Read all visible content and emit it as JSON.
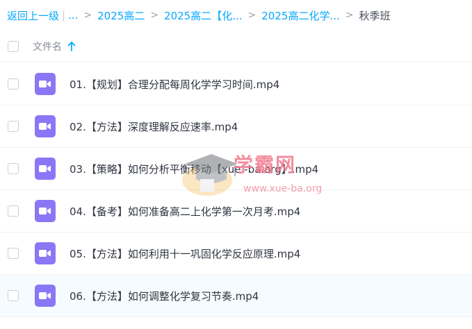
{
  "breadcrumb": {
    "back": "返回上一级",
    "ellipsis": "...",
    "items": [
      "2025高二",
      "2025高二【化...",
      "2025高二化学...",
      "秋季班"
    ]
  },
  "header": {
    "column_name": "文件名"
  },
  "files": [
    {
      "name": "01.【规划】合理分配每周化学学习时间.mp4"
    },
    {
      "name": "02.【方法】深度理解反应速率.mp4"
    },
    {
      "name": "03.【策略】如何分析平衡移动【xue -ba.org】.mp4"
    },
    {
      "name": "04.【备考】如何准备高二上化学第一次月考.mp4"
    },
    {
      "name": "05.【方法】如何利用十一巩固化学反应原理.mp4"
    },
    {
      "name": "06.【方法】如何调整化学复习节奏.mp4"
    }
  ],
  "watermark": {
    "brand": "学霸网",
    "url": "www.xue-ba.org"
  },
  "colors": {
    "accent": "#06a7ff",
    "video_icon": "#8a77f6"
  }
}
